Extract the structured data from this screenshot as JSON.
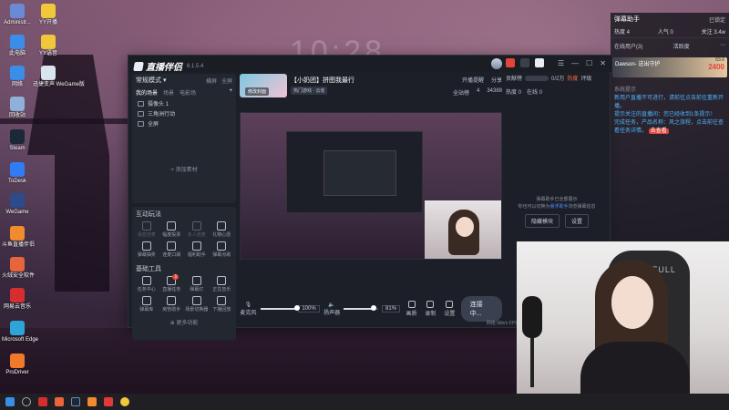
{
  "desktop": {
    "clock": "10:28",
    "icons": [
      {
        "label": "Administr...",
        "color": "#6a8ad8"
      },
      {
        "label": "YY开播",
        "color": "#f0c83a"
      },
      {
        "label": "此电脑",
        "color": "#3b8ee8"
      },
      {
        "label": "YY语音",
        "color": "#f0c83a"
      },
      {
        "label": "网络",
        "color": "#3b8ee8"
      },
      {
        "label": "迅捷变声 WeGame版",
        "color": "#d8e4ee"
      },
      {
        "label": "回收站",
        "color": "#8fb0d8"
      },
      {
        "label": "Steam",
        "color": "#1b2838"
      },
      {
        "label": "ToDesk",
        "color": "#2f7cf5"
      },
      {
        "label": "WeGame",
        "color": "#2d4a8a"
      },
      {
        "label": "斗鱼直播伴侣",
        "color": "#f28a2e"
      },
      {
        "label": "火绒安全软件",
        "color": "#e8643a"
      },
      {
        "label": "网易云音乐",
        "color": "#d62e2e"
      },
      {
        "label": "Microsoft Edge",
        "color": "#2fa4d8"
      },
      {
        "label": "ProDriver",
        "color": "#f07a2a"
      }
    ]
  },
  "app": {
    "name": "直播伴侣",
    "version": "6.1.5.4",
    "left": {
      "mode": "常规模式",
      "mode_right": "横屏",
      "mode_right2": "全屏",
      "scene_tabs": [
        "我的场景",
        "场景",
        "电影场"
      ],
      "sources": [
        "摄像头 1",
        "三角洲行动",
        "全屏"
      ],
      "add_label": "+ 添加素材",
      "interact_title": "互动玩法",
      "interact": [
        "语音连麦",
        "幅度投票",
        "多人连麦",
        "礼物心愿",
        "弹幕抽奖",
        "连麦口袋",
        "福利助手",
        "弹幕点歌"
      ],
      "tools_title": "基础工具",
      "tools": [
        "任务中心",
        "直播任务",
        "弹幕灯",
        "正在音乐",
        "弹幕库",
        "房管助手",
        "场景切换器",
        "下播回放"
      ],
      "tools_badge": "1",
      "more": "更多功能"
    },
    "stream": {
      "thumb_text": "修改封面",
      "title": "【小奶团】拼图我最行",
      "category": "热门游戏 · 云雀",
      "top_actions": [
        "开播提醒",
        "分享"
      ],
      "actions": [
        "全站榜",
        "4",
        "34389"
      ]
    },
    "controls": {
      "mic_label": "麦克风",
      "mic_pct": "100%",
      "mic_level": 1.0,
      "speaker_label": "扬声器",
      "speaker_pct": "81%",
      "speaker_level": 0.81,
      "buttons": [
        "画质",
        "录制",
        "设置"
      ],
      "start": "连接中..."
    },
    "statusbar": "网络 0kb/s   FPS:60   码率:0kbps   CPU:8%   内存:20%   未开播",
    "right": {
      "gift_label": "贡献榜",
      "count": "0/2万",
      "hot": "热度",
      "rank": "评级",
      "stat1": "热度 0",
      "stat2": "在线 0",
      "hint_line1": "弹幕助手已全部展示",
      "hint_line2": "你也可以切换为",
      "hint_link": "悬浮助手",
      "hint_line3": "浏览弹幕信息",
      "btn1": "隐藏模块",
      "btn2": "设置"
    }
  },
  "helper": {
    "title": "弹幕助手",
    "lock": "已锁定",
    "hot": "热度 4",
    "popularity": "人气 0",
    "follow": "关注 3.4w",
    "online": "在线用户(3)",
    "activity": "活跃度",
    "gift_user": "Dawson- 送出守护",
    "gift_value": "2400",
    "gift_count": "63.6",
    "section": "系统提示",
    "msgs": [
      "新用户直播不可进行，请前往点击前往重新开播。",
      "提示关注的直播间：您已经收到1条提示！",
      "完成任务，产品名称：风之旅程，点击前往查看任务详情。"
    ],
    "action": "去查看"
  },
  "camera": {
    "chair_brand": "AUTOFULL"
  }
}
